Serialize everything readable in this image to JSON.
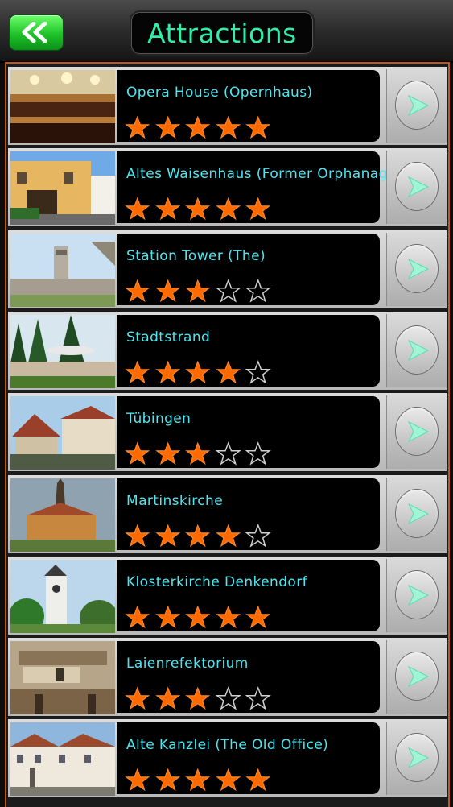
{
  "header": {
    "title": "Attractions",
    "back_icon": "double-chevron-left-icon"
  },
  "colors": {
    "title": "#2df0a8",
    "name_text": "#4ee6f0",
    "star_filled": "#ff6a00",
    "back_button": "#1fc22a",
    "list_border": "#c1561b",
    "play_arrow": "#9ff5d6"
  },
  "attractions": [
    {
      "name": "Opera House (Opernhaus)",
      "rating": 5
    },
    {
      "name": "Altes Waisenhaus (Former Orphanage)",
      "rating": 5
    },
    {
      "name": "Station Tower (The)",
      "rating": 3
    },
    {
      "name": "Stadtstrand",
      "rating": 4
    },
    {
      "name": "Tübingen",
      "rating": 3
    },
    {
      "name": "Martinskirche",
      "rating": 4
    },
    {
      "name": "Klosterkirche Denkendorf",
      "rating": 5
    },
    {
      "name": "Laienrefektorium",
      "rating": 3
    },
    {
      "name": "Alte Kanzlei (The Old Office)",
      "rating": 5
    }
  ]
}
